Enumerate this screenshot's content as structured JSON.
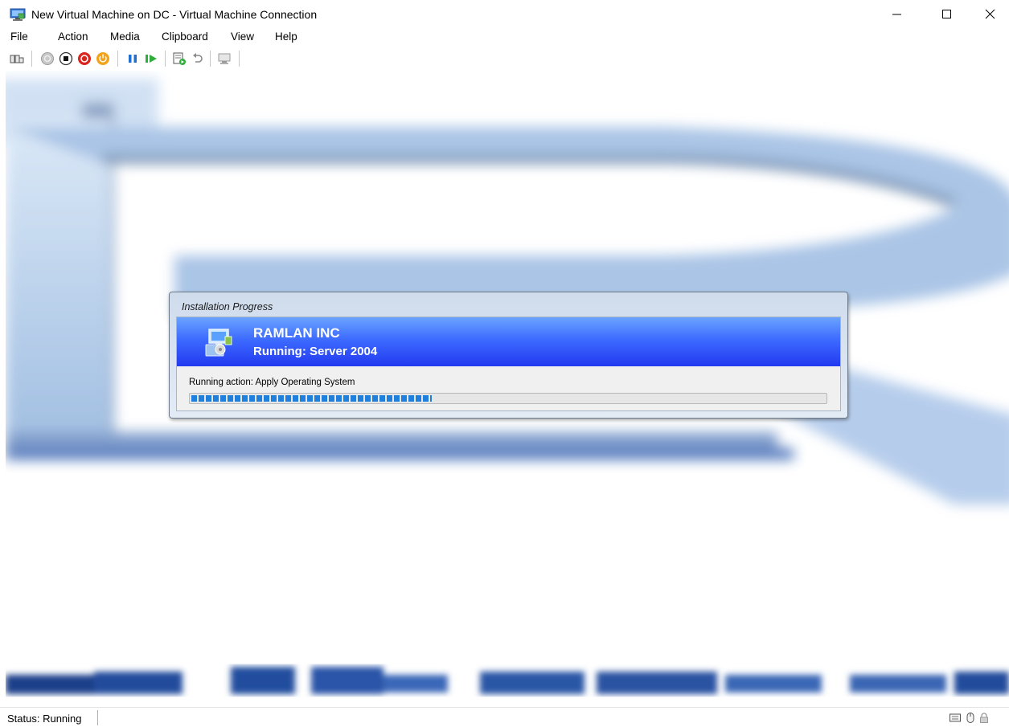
{
  "window": {
    "title": "New Virtual Machine on DC - Virtual Machine Connection",
    "icon": "vm-connection-icon",
    "controls": [
      "minimize-icon",
      "maximize-icon",
      "close-icon"
    ]
  },
  "menu": {
    "items": [
      "File",
      "Action",
      "Media",
      "Clipboard",
      "View",
      "Help"
    ]
  },
  "toolbar": {
    "buttons": [
      "ctrl-alt-del-icon",
      "start-icon",
      "turn-off-icon",
      "shut-down-icon",
      "power-icon",
      "pause-icon",
      "resume-icon",
      "checkpoint-icon",
      "revert-icon",
      "enhanced-session-icon"
    ]
  },
  "dialog": {
    "title": "Installation Progress",
    "organization": "RAMLAN INC",
    "running_title": "Running: Server 2004",
    "action": "Running action: Apply Operating System",
    "progress": 0.38,
    "banner_colors": [
      "#6aa3ff",
      "#2239f0"
    ]
  },
  "statusbar": {
    "status": "Status: Running",
    "icons": [
      "keyboard-icon",
      "mouse-icon",
      "lock-icon"
    ]
  }
}
